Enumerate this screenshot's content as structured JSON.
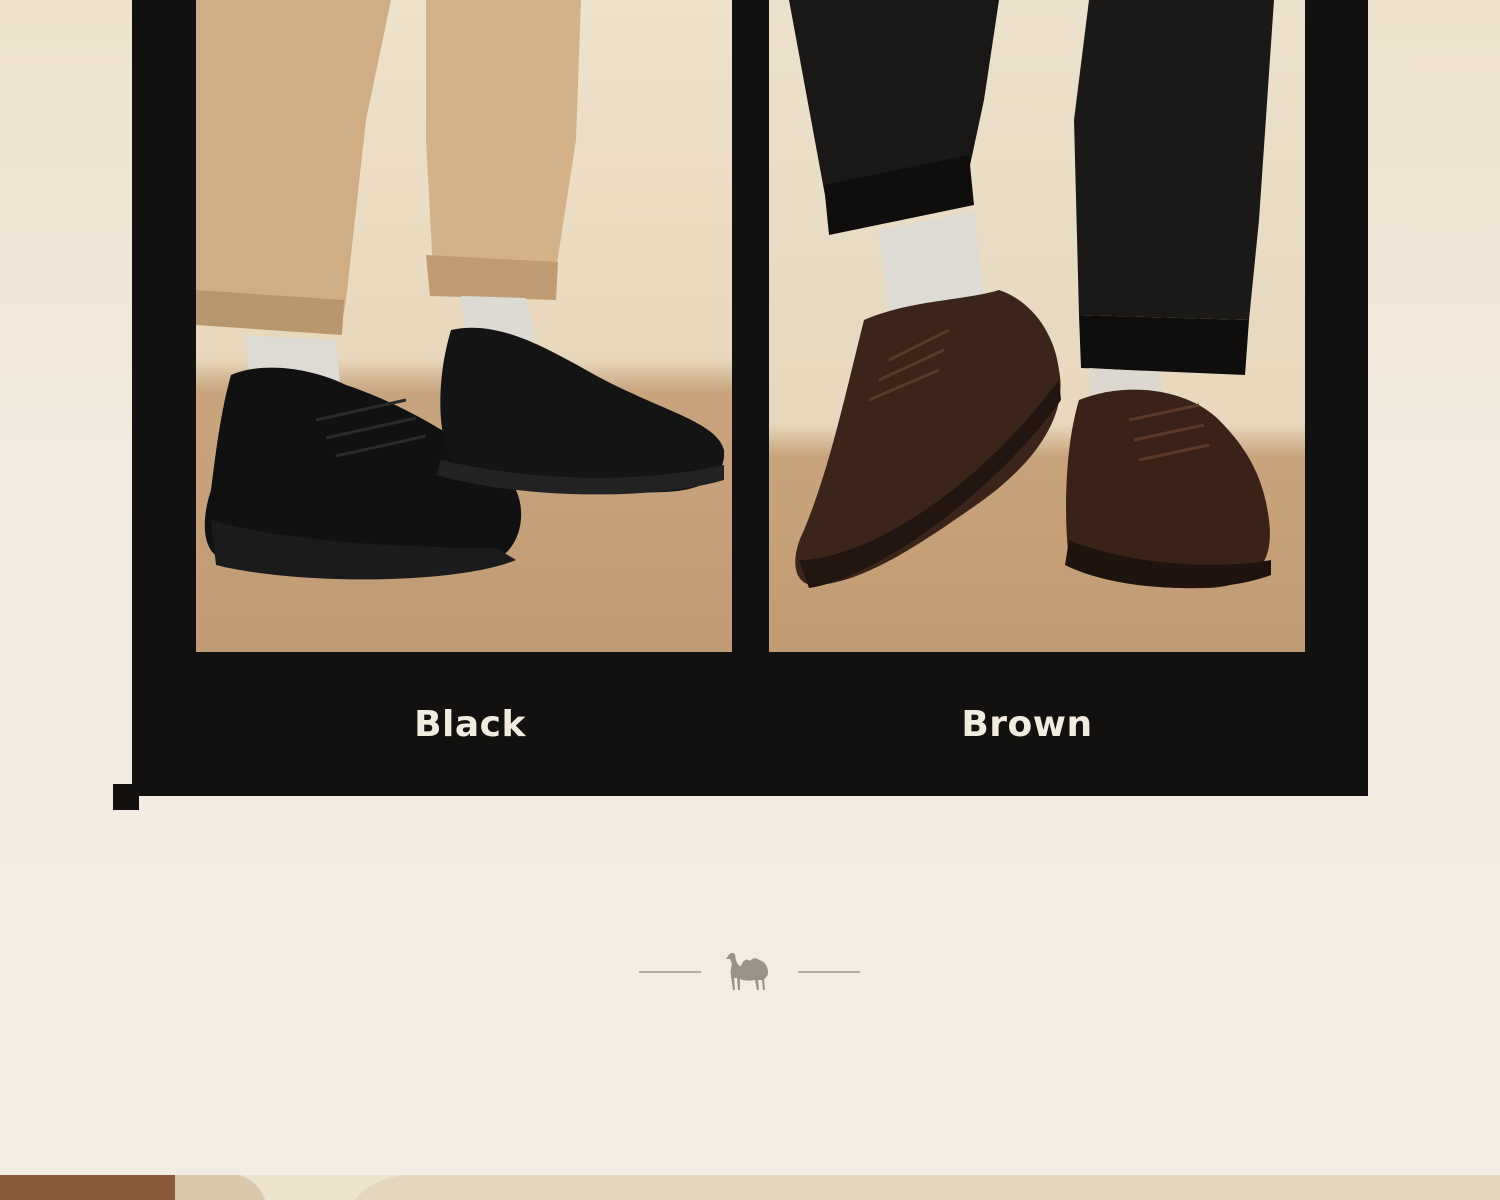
{
  "variants": [
    {
      "label": "Black",
      "accent": "#121110"
    },
    {
      "label": "Brown",
      "accent": "#4a2c1e"
    }
  ],
  "colors": {
    "background": "#f2ebe1",
    "card": "#121110",
    "label_text": "#f2ebe0",
    "divider": "#b5aea4",
    "logo": "#9a9288"
  },
  "icons": {
    "brand_logo": "camel-logo-icon"
  }
}
